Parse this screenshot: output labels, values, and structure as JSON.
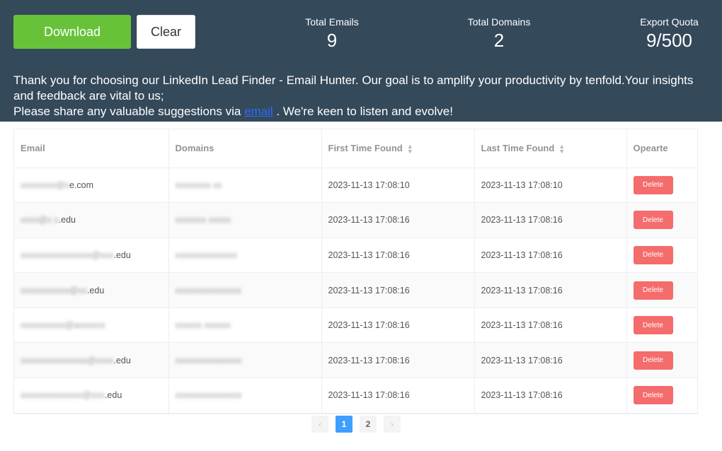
{
  "header": {
    "download_label": "Download",
    "clear_label": "Clear",
    "stats": {
      "emails_label": "Total Emails",
      "emails_value": "9",
      "domains_label": "Total Domains",
      "domains_value": "2",
      "quota_label": "Export Quota",
      "quota_value": "9/500"
    },
    "notice": {
      "text_1": "Thank you for choosing our LinkedIn Lead Finder - Email Hunter. Our goal is to amplify your productivity by tenfold.Your insights and feedback are vital to us;",
      "text_2": "Please share any valuable suggestions via ",
      "link": "email",
      "text_3": " . We're keen to listen and evolve!"
    }
  },
  "table": {
    "columns": [
      "Email",
      "Domains",
      "First Time Found",
      "Last Time Found",
      "Opearte"
    ],
    "delete_label": "Delete",
    "rows": [
      {
        "email_blur": "xxxxxxxx@x",
        "email_domain": "e.com",
        "domain_blur": "xxxxxxxx xx",
        "first": "2023-11-13 17:08:10",
        "last": "2023-11-13 17:08:10"
      },
      {
        "email_blur": "xxxx@x x",
        "email_domain": ".edu",
        "domain_blur": "xxxxxxx xxxxx",
        "first": "2023-11-13 17:08:16",
        "last": "2023-11-13 17:08:16"
      },
      {
        "email_blur": "xxxxxxxxxxxxxxxx@xxx",
        "email_domain": ".edu",
        "domain_blur": "xxxxxxxxxxxxxx",
        "first": "2023-11-13 17:08:16",
        "last": "2023-11-13 17:08:16"
      },
      {
        "email_blur": "xxxxxxxxxxx@xx",
        "email_domain": ".edu",
        "domain_blur": "xxxxxxxxxxxxxxx",
        "first": "2023-11-13 17:08:16",
        "last": "2023-11-13 17:08:16"
      },
      {
        "email_blur": "xxxxxxxxxx@axxxxxx",
        "email_domain": "",
        "domain_blur": "xxxxxx xxxxxx",
        "first": "2023-11-13 17:08:16",
        "last": "2023-11-13 17:08:16"
      },
      {
        "email_blur": "xxxxxxxxxxxxxxx@xxxx",
        "email_domain": ".edu",
        "domain_blur": "xxxxxxxxxxxxxxx",
        "first": "2023-11-13 17:08:16",
        "last": "2023-11-13 17:08:16"
      },
      {
        "email_blur": "xxxxxxxxxxxxxx@xxx",
        "email_domain": ".edu",
        "domain_blur": "xxxxxxxxxxxxxxx",
        "first": "2023-11-13 17:08:16",
        "last": "2023-11-13 17:08:16"
      }
    ]
  },
  "pagination": {
    "prev": "‹",
    "pages": [
      "1",
      "2"
    ],
    "next": "›",
    "active_page": "1"
  },
  "colors": {
    "header_bg": "#34495a",
    "download": "#67c23a",
    "delete": "#f56c6c",
    "active_page": "#409eff"
  }
}
